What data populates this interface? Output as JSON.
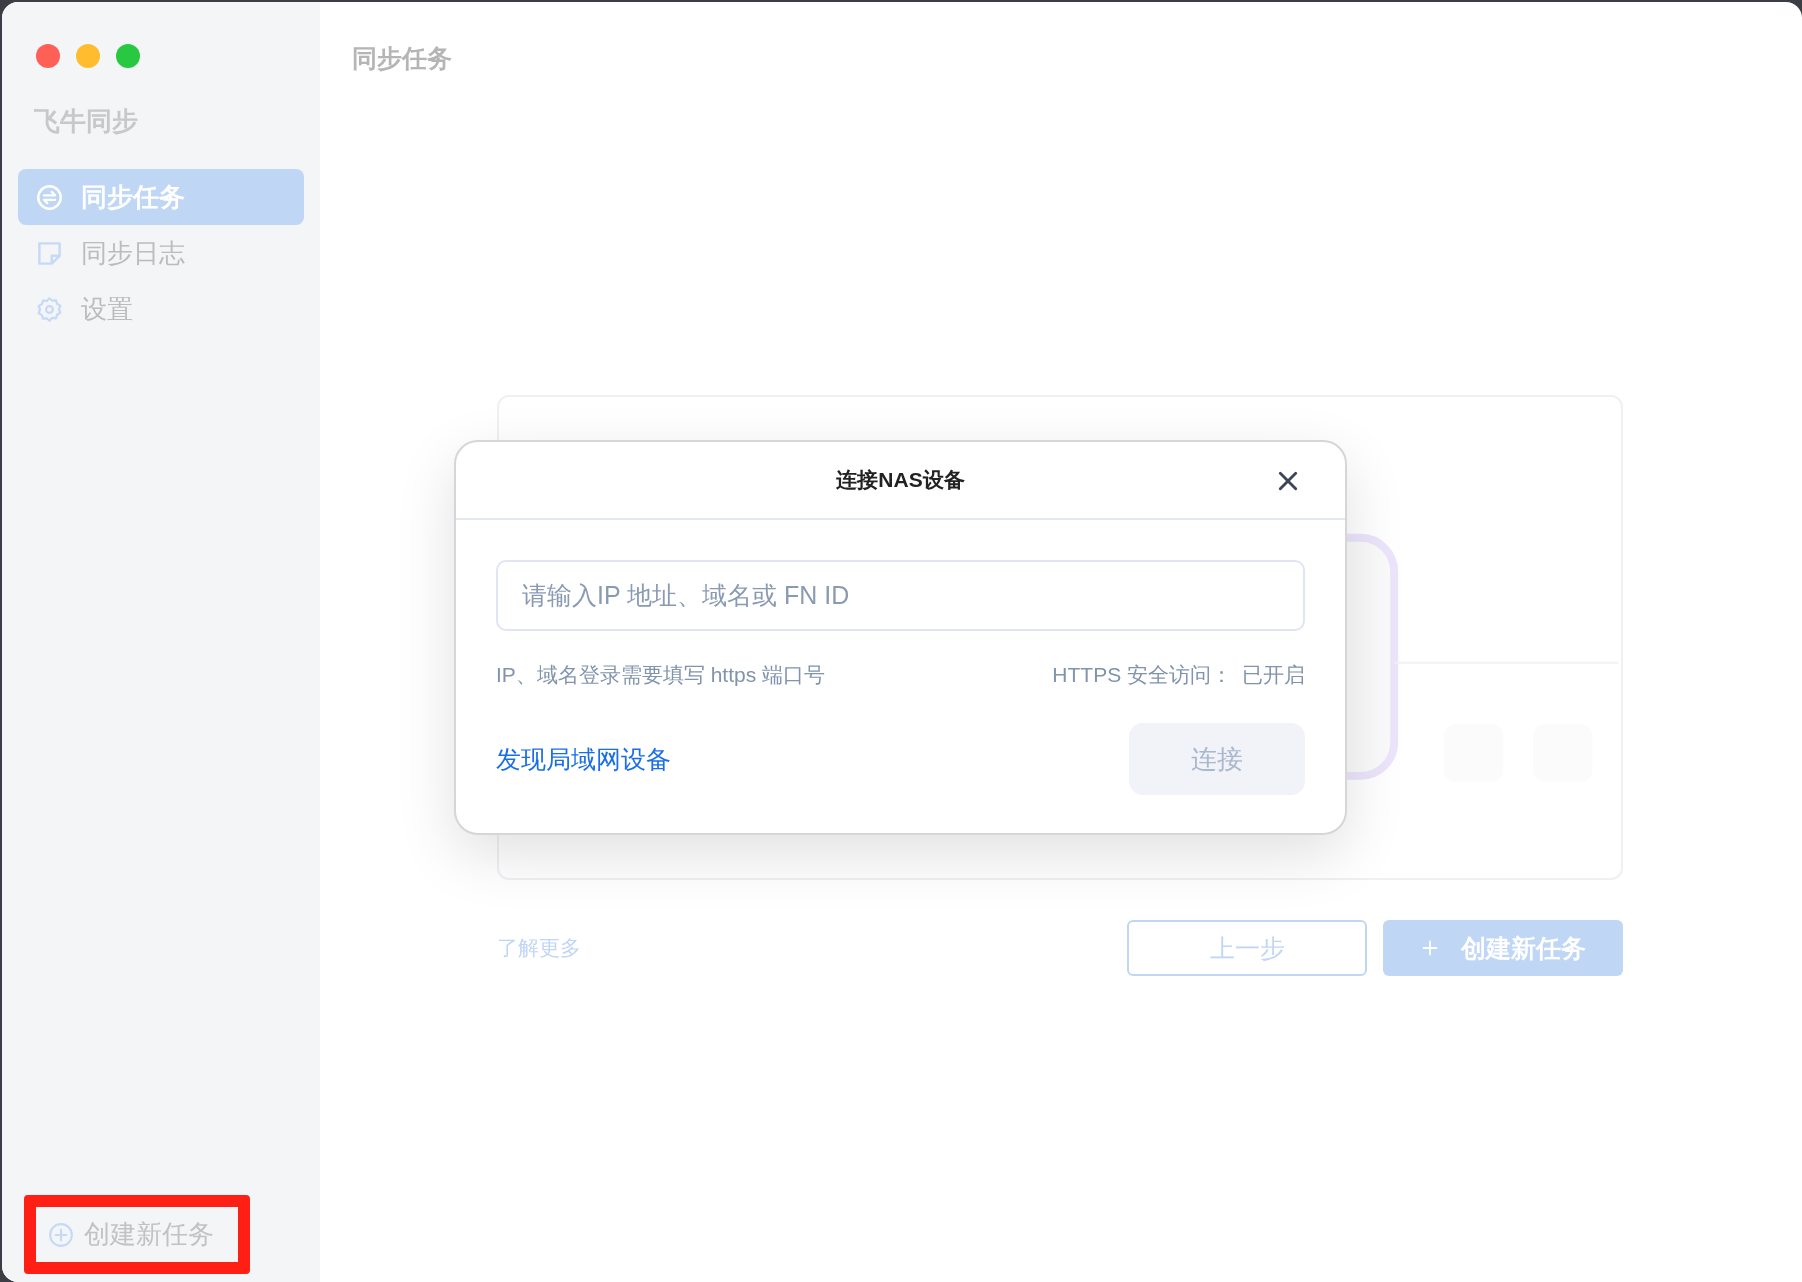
{
  "sidebar": {
    "app_name": "飞牛同步",
    "items": [
      {
        "label": "同步任务",
        "kind": "sync",
        "selected": true
      },
      {
        "label": "同步日志",
        "kind": "log",
        "selected": false
      },
      {
        "label": "设置",
        "kind": "settings",
        "selected": false
      }
    ],
    "create_task": {
      "label": "创建新任务",
      "highlighted": true
    }
  },
  "main": {
    "title": "同步任务",
    "learn_more": "了解更多",
    "back_button": "上一步",
    "create_button": "创建新任务"
  },
  "dialog": {
    "title": "连接NAS设备",
    "input": {
      "placeholder": "请输入IP 地址、域名或 FN ID"
    },
    "hint": "IP、域名登录需要填写 https 端口号",
    "https_label": "HTTPS 安全访问：",
    "https_status": "已开启",
    "discover_link": "发现局域网设备",
    "connect_button": {
      "label": "连接",
      "disabled": true
    }
  }
}
